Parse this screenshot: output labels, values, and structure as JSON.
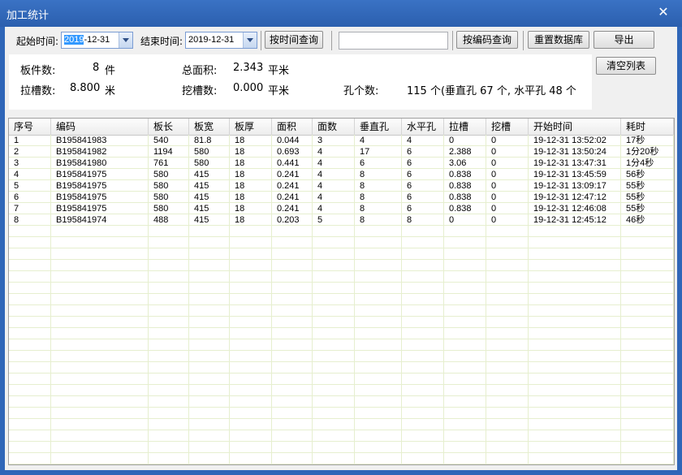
{
  "window": {
    "title": "加工统计",
    "close_glyph": "✕"
  },
  "toolbar": {
    "start_label": "起始时间:",
    "start_value_highlight": "2019",
    "start_value_rest": "-12-31",
    "end_label": "结束时间:",
    "end_value": "2019-12-31",
    "query_time": "按时间查询",
    "code_input": "",
    "query_code": "按编码查询",
    "reset_db": "重置数据库",
    "export": "导出",
    "clear_list": "清空列表"
  },
  "stats": {
    "boards_label": "板件数:",
    "boards_value": "8",
    "boards_unit": "件",
    "area_label": "总面积:",
    "area_value": "2.343",
    "area_unit": "平米",
    "groove_label": "拉槽数:",
    "groove_value": "8.800",
    "groove_unit": "米",
    "pocket_label": "挖槽数:",
    "pocket_value": "0.000",
    "pocket_unit": "平米",
    "holes_label": "孔个数:",
    "holes_value": "115 个(垂直孔 67 个, 水平孔 48 个"
  },
  "table": {
    "columns": [
      "序号",
      "编码",
      "板长",
      "板宽",
      "板厚",
      "面积",
      "面数",
      "垂直孔",
      "水平孔",
      "拉槽",
      "挖槽",
      "开始时间",
      "耗时"
    ],
    "rows": [
      [
        "1",
        "B195841983",
        "540",
        "81.8",
        "18",
        "0.044",
        "3",
        "4",
        "4",
        "0",
        "0",
        "19-12-31 13:52:02",
        "17秒"
      ],
      [
        "2",
        "B195841982",
        "1194",
        "580",
        "18",
        "0.693",
        "4",
        "17",
        "6",
        "2.388",
        "0",
        "19-12-31 13:50:24",
        "1分20秒"
      ],
      [
        "3",
        "B195841980",
        "761",
        "580",
        "18",
        "0.441",
        "4",
        "6",
        "6",
        "3.06",
        "0",
        "19-12-31 13:47:31",
        "1分4秒"
      ],
      [
        "4",
        "B195841975",
        "580",
        "415",
        "18",
        "0.241",
        "4",
        "8",
        "6",
        "0.838",
        "0",
        "19-12-31 13:45:59",
        "56秒"
      ],
      [
        "5",
        "B195841975",
        "580",
        "415",
        "18",
        "0.241",
        "4",
        "8",
        "6",
        "0.838",
        "0",
        "19-12-31 13:09:17",
        "55秒"
      ],
      [
        "6",
        "B195841975",
        "580",
        "415",
        "18",
        "0.241",
        "4",
        "8",
        "6",
        "0.838",
        "0",
        "19-12-31 12:47:12",
        "55秒"
      ],
      [
        "7",
        "B195841975",
        "580",
        "415",
        "18",
        "0.241",
        "4",
        "8",
        "6",
        "0.838",
        "0",
        "19-12-31 12:46:08",
        "55秒"
      ],
      [
        "8",
        "B195841974",
        "488",
        "415",
        "18",
        "0.203",
        "5",
        "8",
        "8",
        "0",
        "0",
        "19-12-31 12:45:12",
        "46秒"
      ]
    ]
  }
}
